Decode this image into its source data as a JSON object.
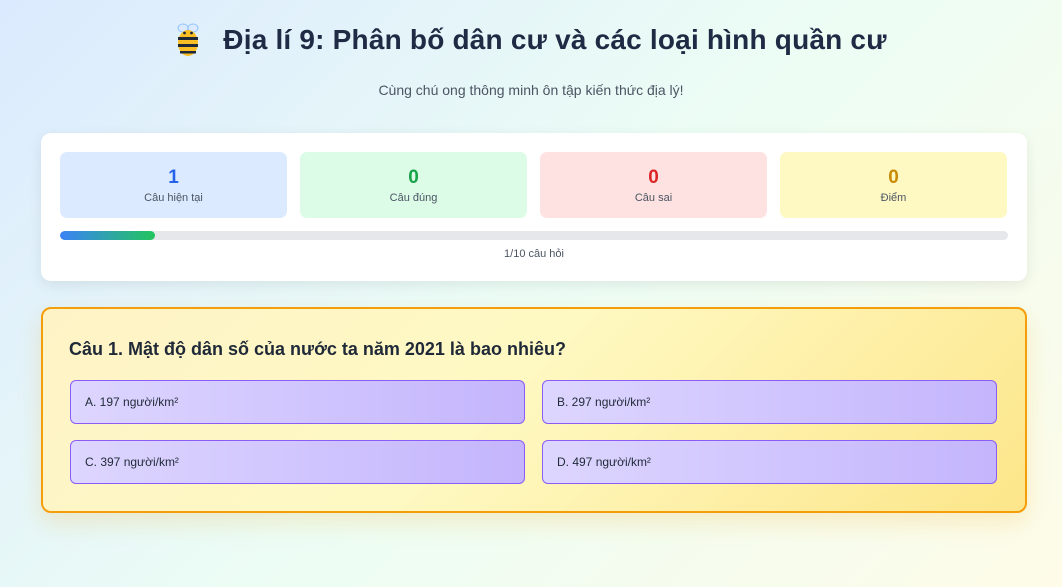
{
  "header": {
    "icon": "bee-icon",
    "title": "Địa lí 9: Phân bố dân cư và các loại hình quần cư",
    "subtitle": "Cùng chú ong thông minh ôn tập kiến thức địa lý!"
  },
  "stats": {
    "current": {
      "value": "1",
      "label": "Câu hiện tại",
      "color": "#2563eb"
    },
    "correct": {
      "value": "0",
      "label": "Câu đúng",
      "color": "#16a34a"
    },
    "wrong": {
      "value": "0",
      "label": "Câu sai",
      "color": "#dc2626"
    },
    "score": {
      "value": "0",
      "label": "Điểm",
      "color": "#ca8a04"
    }
  },
  "progress": {
    "fraction": 0.1,
    "text": "1/10 câu hỏi"
  },
  "question": {
    "text": "Câu 1. Mật độ dân số của nước ta năm 2021 là bao nhiêu?",
    "options": [
      {
        "label": "A. 197 người/km²"
      },
      {
        "label": "B. 297 người/km²"
      },
      {
        "label": "C. 397 người/km²"
      },
      {
        "label": "D. 497 người/km²"
      }
    ]
  },
  "colors": {
    "accent_border": "#f59e0b",
    "option_border": "#8b5cf6"
  }
}
